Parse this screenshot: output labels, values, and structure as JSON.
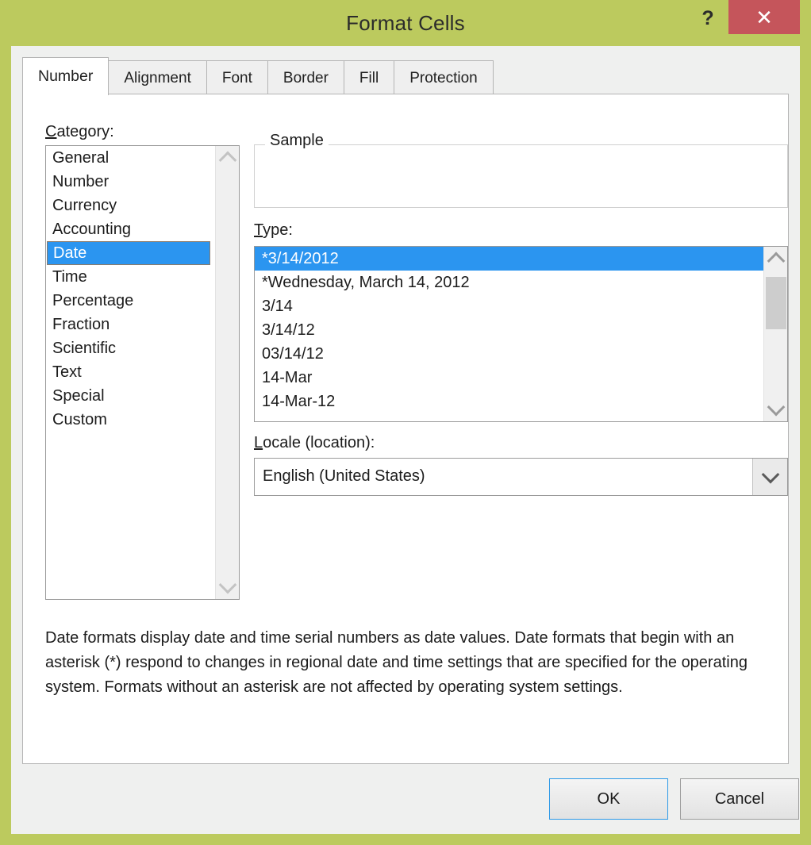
{
  "window": {
    "title": "Format Cells",
    "help_icon": "question-mark-icon",
    "close_icon": "close-x-icon",
    "titlebar_color": "#bcca5e",
    "close_button_color": "#c5555b",
    "accent_selection_color": "#2b95f0"
  },
  "tabs": [
    {
      "label": "Number",
      "active": true
    },
    {
      "label": "Alignment",
      "active": false
    },
    {
      "label": "Font",
      "active": false
    },
    {
      "label": "Border",
      "active": false
    },
    {
      "label": "Fill",
      "active": false
    },
    {
      "label": "Protection",
      "active": false
    }
  ],
  "category": {
    "label_prefix": "C",
    "label_rest": "ategory:",
    "items": [
      "General",
      "Number",
      "Currency",
      "Accounting",
      "Date",
      "Time",
      "Percentage",
      "Fraction",
      "Scientific",
      "Text",
      "Special",
      "Custom"
    ],
    "selected": "Date",
    "selected_index": 4
  },
  "sample": {
    "legend": "Sample",
    "value": ""
  },
  "type": {
    "label_prefix": "T",
    "label_rest": "ype:",
    "items": [
      "*3/14/2012",
      "*Wednesday, March 14, 2012",
      "3/14",
      "3/14/12",
      "03/14/12",
      "14-Mar",
      "14-Mar-12"
    ],
    "selected": "*3/14/2012",
    "selected_index": 0
  },
  "locale": {
    "label_prefix": "L",
    "label_rest": "ocale (location):",
    "value": "English (United States)",
    "dropdown_icon": "chevron-down-icon"
  },
  "description": "Date formats display date and time serial numbers as date values.  Date formats that begin with an asterisk (*) respond to changes in regional date and time settings that are specified for the operating system. Formats without an asterisk are not affected by operating system settings.",
  "footer": {
    "ok_label": "OK",
    "cancel_label": "Cancel"
  }
}
